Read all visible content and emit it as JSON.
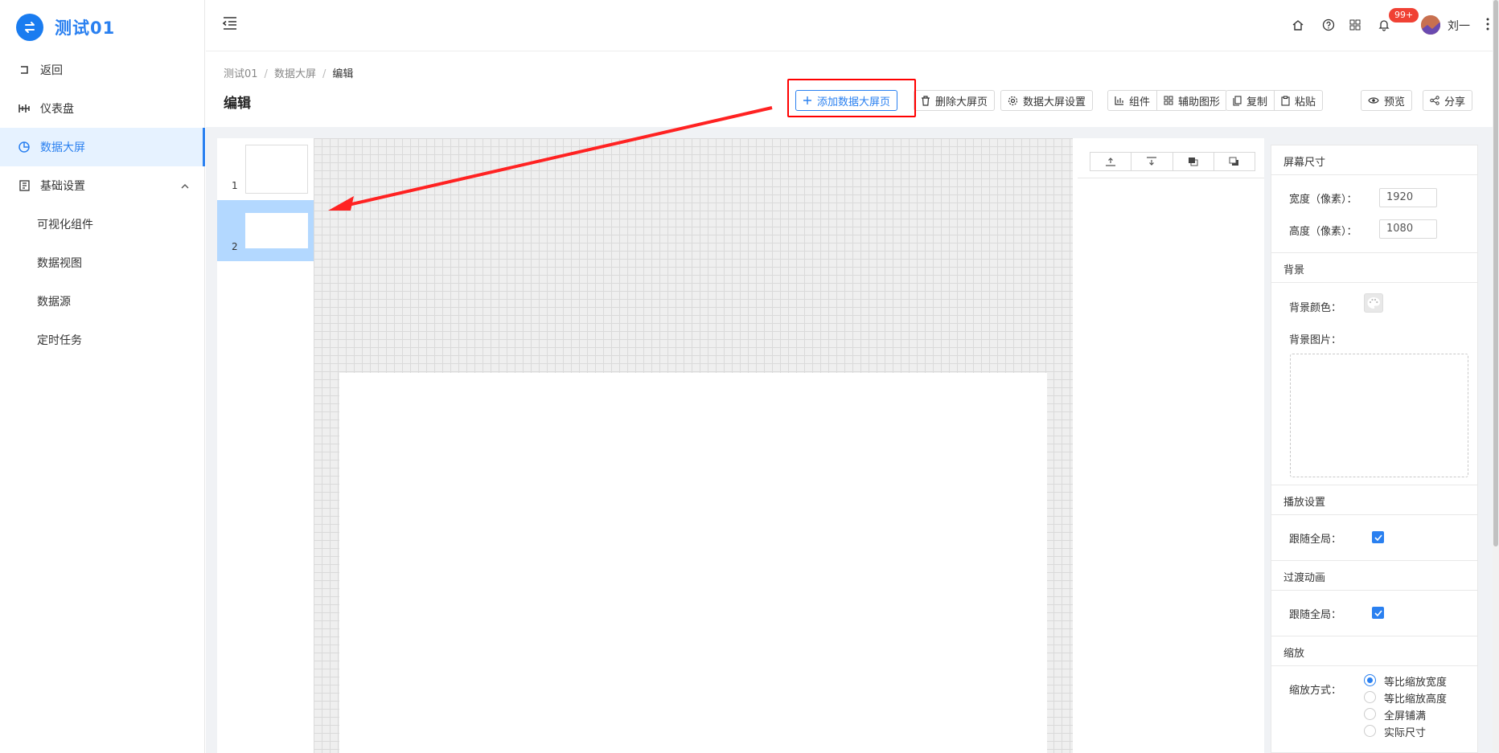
{
  "app": {
    "title": "测试01"
  },
  "sidebar": {
    "items": [
      {
        "label": "返回",
        "icon": "return-icon"
      },
      {
        "label": "仪表盘",
        "icon": "dashboard-icon"
      },
      {
        "label": "数据大屏",
        "icon": "pie-chart-icon",
        "active": true
      },
      {
        "label": "基础设置",
        "icon": "settings-book-icon",
        "expanded": true
      }
    ],
    "subitems": [
      {
        "label": "可视化组件"
      },
      {
        "label": "数据视图"
      },
      {
        "label": "数据源"
      },
      {
        "label": "定时任务"
      }
    ]
  },
  "topbar": {
    "notification_badge": "99+",
    "user_name": "刘一"
  },
  "breadcrumb": [
    {
      "label": "测试01"
    },
    {
      "label": "数据大屏"
    },
    {
      "label": "编辑"
    }
  ],
  "page": {
    "title": "编辑"
  },
  "toolbar": {
    "add_page": "添加数据大屏页",
    "delete_page": "删除大屏页",
    "screen_settings": "数据大屏设置",
    "components": "组件",
    "aux_shapes": "辅助图形",
    "copy": "复制",
    "paste": "粘贴",
    "preview": "预览",
    "share": "分享"
  },
  "pages_list": [
    {
      "number": "1"
    },
    {
      "number": "2",
      "selected": true
    }
  ],
  "props": {
    "screen_size": {
      "title": "屏幕尺寸",
      "width_label": "宽度（像素）：",
      "width_value": "1920",
      "height_label": "高度（像素）：",
      "height_value": "1080"
    },
    "background": {
      "title": "背景",
      "color_label": "背景颜色：",
      "image_label": "背景图片："
    },
    "playback": {
      "title": "播放设置",
      "follow_label": "跟随全局：",
      "follow_checked": true
    },
    "transition": {
      "title": "过渡动画",
      "follow_label": "跟随全局：",
      "follow_checked": true
    },
    "zoom": {
      "title": "缩放",
      "mode_label": "缩放方式：",
      "options": [
        "等比缩放宽度",
        "等比缩放高度",
        "全屏铺满",
        "实际尺寸"
      ],
      "selected": "等比缩放宽度"
    }
  },
  "colors": {
    "accent": "#2a80f0",
    "highlight": "#ff0000",
    "badge": "#f04134"
  }
}
